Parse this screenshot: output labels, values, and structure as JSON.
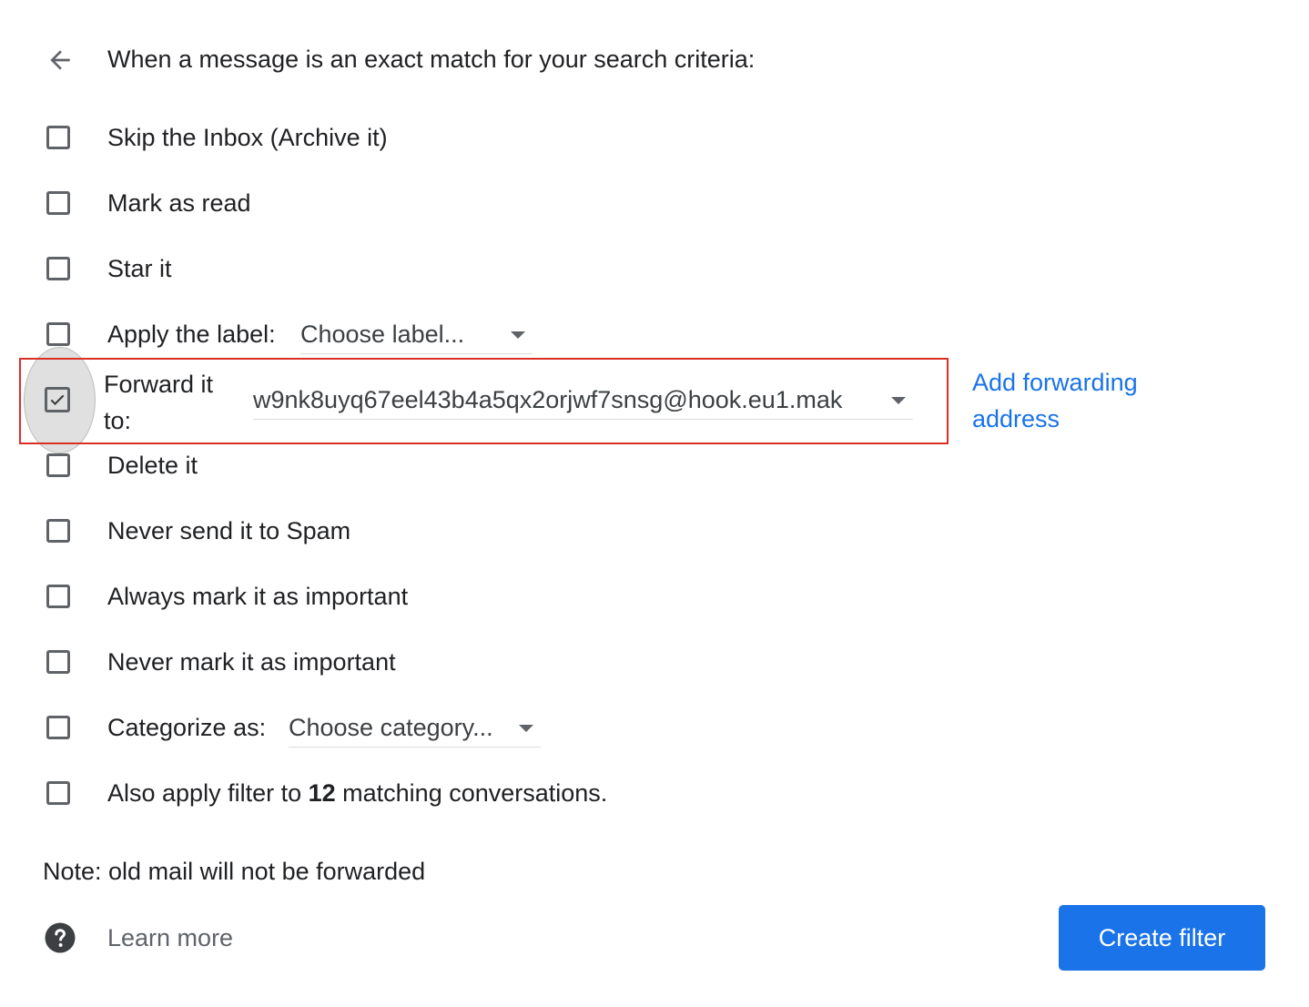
{
  "header": {
    "back_icon": "arrow-left-icon",
    "title": "When a message is an exact match for your search criteria:"
  },
  "actions": {
    "skip_inbox": "Skip the Inbox (Archive it)",
    "mark_read": "Mark as read",
    "star": "Star it",
    "apply_label": {
      "label": "Apply the label:",
      "select_value": "Choose label..."
    },
    "forward": {
      "label": "Forward it to:",
      "checked": true,
      "select_value": "w9nk8uyq67eel43b4a5qx2orjwf7snsg@hook.eu1.mak",
      "add_link": "Add forwarding address"
    },
    "delete": "Delete it",
    "never_spam": "Never send it to Spam",
    "always_important": "Always mark it as important",
    "never_important": "Never mark it as important",
    "categorize": {
      "label": "Categorize as:",
      "select_value": "Choose category..."
    },
    "also_apply": {
      "prefix": "Also apply filter to ",
      "count": "12",
      "suffix": " matching conversations."
    }
  },
  "note": "Note: old mail will not be forwarded",
  "footer": {
    "help_icon": "help-circle-icon",
    "learn_more": "Learn more",
    "create_button": "Create filter"
  },
  "colors": {
    "accent": "#1a73e8",
    "highlight_border": "#d93025",
    "checkbox_border": "#5f6368"
  }
}
